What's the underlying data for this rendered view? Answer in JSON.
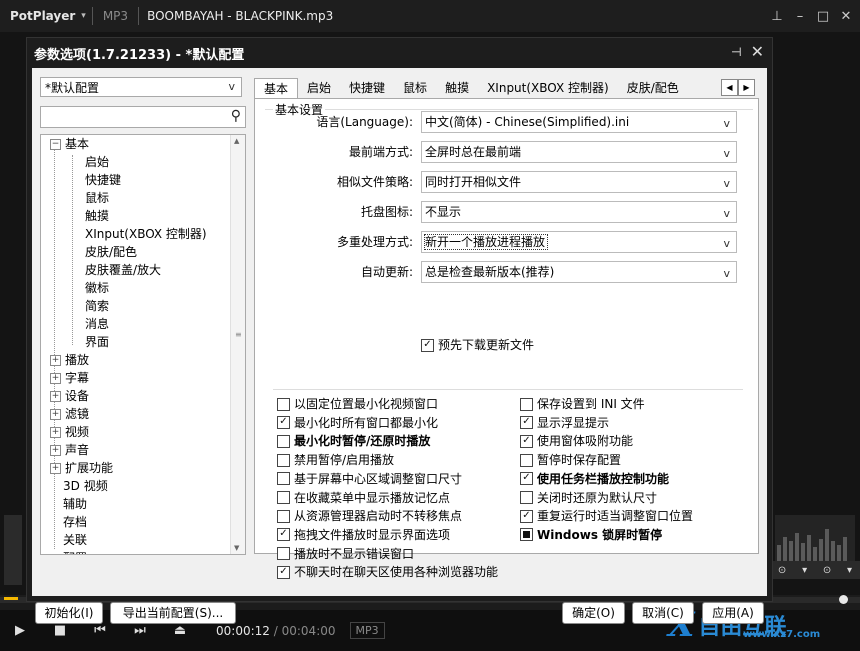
{
  "player": {
    "logo": "PotPlayer",
    "format": "MP3",
    "file_title": "BOOMBAYAH - BLACKPINK.mp3",
    "time_current": "00:00:12",
    "time_sep": "/",
    "time_total": "00:04:00",
    "format_badge": "MP3",
    "watermark_text": "自由互联",
    "watermark_url": "www.xz7.com"
  },
  "dialog": {
    "title": "参数选项(1.7.21233) - *默认配置",
    "profile": "*默认配置",
    "tree": [
      {
        "label": "基本",
        "level": 0,
        "exp": "−"
      },
      {
        "label": "启始",
        "level": 1
      },
      {
        "label": "快捷键",
        "level": 1
      },
      {
        "label": "鼠标",
        "level": 1
      },
      {
        "label": "触摸",
        "level": 1
      },
      {
        "label": "XInput(XBOX 控制器)",
        "level": 1
      },
      {
        "label": "皮肤/配色",
        "level": 1
      },
      {
        "label": "皮肤覆盖/放大",
        "level": 1
      },
      {
        "label": "徽标",
        "level": 1
      },
      {
        "label": "简索",
        "level": 1
      },
      {
        "label": "消息",
        "level": 1
      },
      {
        "label": "界面",
        "level": 1
      },
      {
        "label": "播放",
        "level": 0,
        "exp": "+"
      },
      {
        "label": "字幕",
        "level": 0,
        "exp": "+"
      },
      {
        "label": "设备",
        "level": 0,
        "exp": "+"
      },
      {
        "label": "滤镜",
        "level": 0,
        "exp": "+"
      },
      {
        "label": "视频",
        "level": 0,
        "exp": "+"
      },
      {
        "label": "声音",
        "level": 0,
        "exp": "+"
      },
      {
        "label": "扩展功能",
        "level": 0,
        "exp": "+"
      },
      {
        "label": "3D 视频",
        "level": 0
      },
      {
        "label": "辅助",
        "level": 0
      },
      {
        "label": "存档",
        "level": 0
      },
      {
        "label": "关联",
        "level": 0
      },
      {
        "label": "配置",
        "level": 0
      }
    ],
    "tabs": [
      "基本",
      "启始",
      "快捷键",
      "鼠标",
      "触摸",
      "XInput(XBOX 控制器)",
      "皮肤/配色"
    ],
    "group_title": "基本设置",
    "settings": [
      {
        "label": "语言(Language):",
        "value": "中文(简体) - Chinese(Simplified).ini"
      },
      {
        "label": "最前端方式:",
        "value": "全屏时总在最前端"
      },
      {
        "label": "相似文件策略:",
        "value": "同时打开相似文件"
      },
      {
        "label": "托盘图标:",
        "value": "不显示"
      },
      {
        "label": "多重处理方式:",
        "value": "新开一个播放进程播放"
      },
      {
        "label": "自动更新:",
        "value": "总是检查最新版本(推荐)"
      }
    ],
    "predownload": {
      "label": "预先下载更新文件",
      "checked": true
    },
    "options_left": [
      {
        "label": "以固定位置最小化视频窗口",
        "checked": false,
        "bold": false
      },
      {
        "label": "最小化时所有窗口都最小化",
        "checked": true,
        "bold": false
      },
      {
        "label": "最小化时暂停/还原时播放",
        "checked": false,
        "bold": true
      },
      {
        "label": "禁用暂停/启用播放",
        "checked": false,
        "bold": false
      },
      {
        "label": "基于屏幕中心区域调整窗口尺寸",
        "checked": false,
        "bold": false
      },
      {
        "label": "在收藏菜单中显示播放记忆点",
        "checked": false,
        "bold": false
      },
      {
        "label": "从资源管理器启动时不转移焦点",
        "checked": false,
        "bold": false
      },
      {
        "label": "拖拽文件播放时显示界面选项",
        "checked": true,
        "bold": false
      },
      {
        "label": "播放时不显示错误窗口",
        "checked": false,
        "bold": false
      },
      {
        "label": "不聊天时在聊天区使用各种浏览器功能",
        "checked": true,
        "bold": false
      }
    ],
    "options_right": [
      {
        "label": "保存设置到 INI 文件",
        "checked": false,
        "bold": false
      },
      {
        "label": "显示浮显提示",
        "checked": true,
        "bold": false
      },
      {
        "label": "使用窗体吸附功能",
        "checked": true,
        "bold": false
      },
      {
        "label": "暂停时保存配置",
        "checked": false,
        "bold": false
      },
      {
        "label": "使用任务栏播放控制功能",
        "checked": true,
        "bold": true
      },
      {
        "label": "关闭时还原为默认尺寸",
        "checked": false,
        "bold": false
      },
      {
        "label": "重复运行时适当调整窗口位置",
        "checked": true,
        "bold": false
      },
      {
        "label": "Windows 锁屏时暂停",
        "checked": "indeterminate",
        "bold": true
      }
    ],
    "buttons": {
      "reset": "初始化(I)",
      "export": "导出当前配置(S)...",
      "ok": "确定(O)",
      "cancel": "取消(C)",
      "apply": "应用(A)"
    }
  }
}
